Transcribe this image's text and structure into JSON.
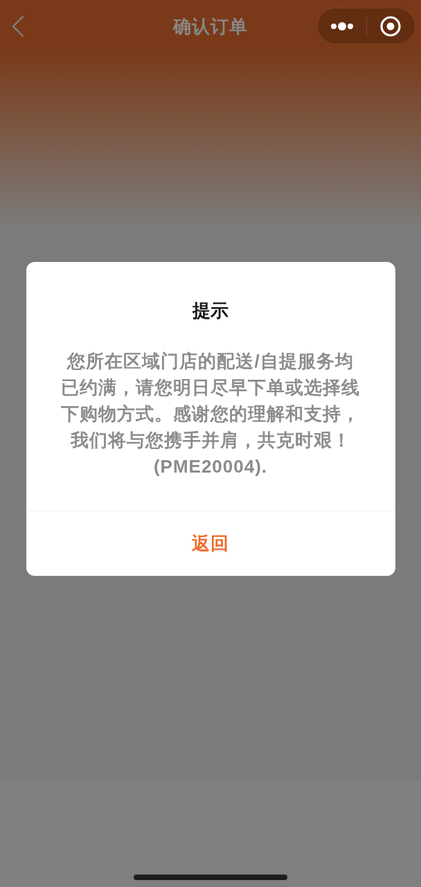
{
  "nav_bar": {
    "title": "确认订单"
  },
  "dialog": {
    "title": "提示",
    "message": "您所在区域门店的配送/自提服务均已约满，请您明日尽早下单或选择线下购物方式。感谢您的理解和支持，我们将与您携手并肩，共克时艰！(PME20004).",
    "buttons": [
      "返回"
    ]
  }
}
